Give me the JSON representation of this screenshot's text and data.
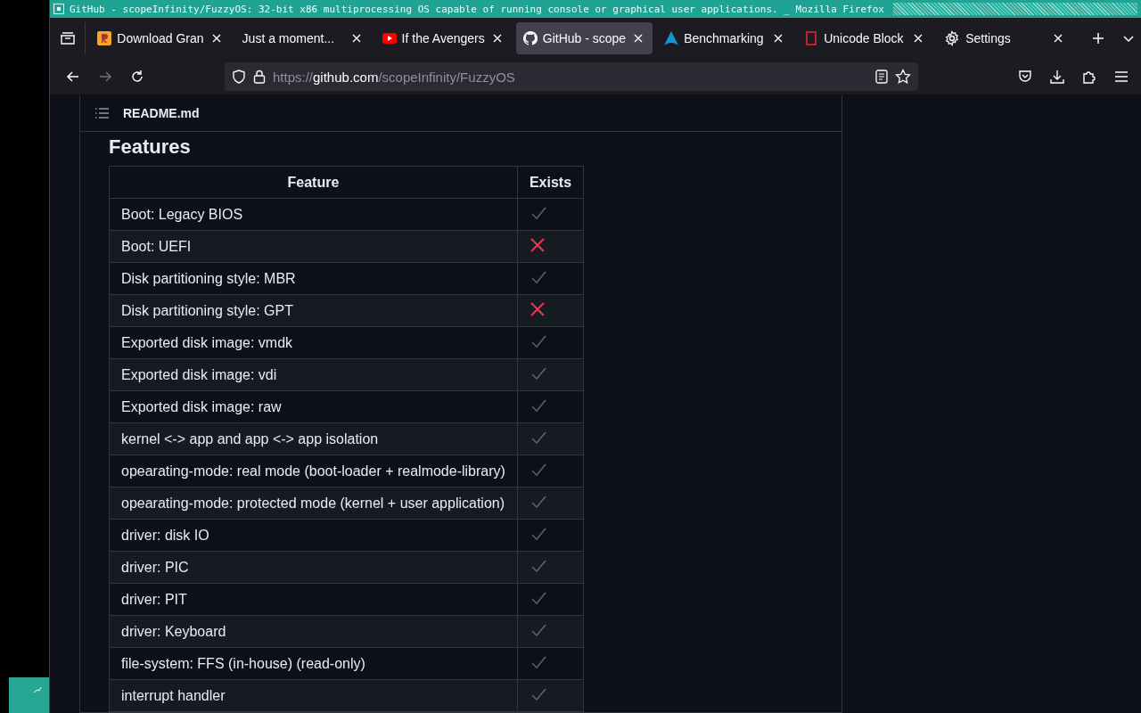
{
  "window": {
    "title": "GitHub - scopeInfinity/FuzzyOS: 32-bit x86 multiprocessing OS capable of running console or graphical user applications. _ Mozilla Firefox"
  },
  "tabs": [
    {
      "label": "Download Gran",
      "selected": false
    },
    {
      "label": "Just a moment...",
      "selected": false
    },
    {
      "label": "If the Avengers",
      "selected": false
    },
    {
      "label": "GitHub - scope",
      "selected": true
    },
    {
      "label": "Benchmarking",
      "selected": false
    },
    {
      "label": "Unicode Block",
      "selected": false
    },
    {
      "label": "Settings",
      "selected": false
    }
  ],
  "address_bar": {
    "scheme": "https://",
    "domain": "github.com",
    "path": "/scopeInfinity/FuzzyOS"
  },
  "readme": {
    "file_name": "README.md",
    "heading": "Features",
    "table": {
      "columns": [
        "Feature",
        "Exists"
      ],
      "rows": [
        {
          "feature": "Boot: Legacy BIOS",
          "exists": true
        },
        {
          "feature": "Boot: UEFI",
          "exists": false
        },
        {
          "feature": "Disk partitioning style: MBR",
          "exists": true
        },
        {
          "feature": "Disk partitioning style: GPT",
          "exists": false
        },
        {
          "feature": "Exported disk image: vmdk",
          "exists": true
        },
        {
          "feature": "Exported disk image: vdi",
          "exists": true
        },
        {
          "feature": "Exported disk image: raw",
          "exists": true
        },
        {
          "feature": "kernel <-> app and app <-> app isolation",
          "exists": true
        },
        {
          "feature": "opearating-mode: real mode (boot-loader + realmode-library)",
          "exists": true
        },
        {
          "feature": "opearating-mode: protected mode (kernel + user application)",
          "exists": true
        },
        {
          "feature": "driver: disk IO",
          "exists": true
        },
        {
          "feature": "driver: PIC",
          "exists": true
        },
        {
          "feature": "driver: PIT",
          "exists": true
        },
        {
          "feature": "driver: Keyboard",
          "exists": true
        },
        {
          "feature": "file-system: FFS (in-house) (read-only)",
          "exists": true
        },
        {
          "feature": "interrupt handler",
          "exists": true
        }
      ]
    }
  }
}
